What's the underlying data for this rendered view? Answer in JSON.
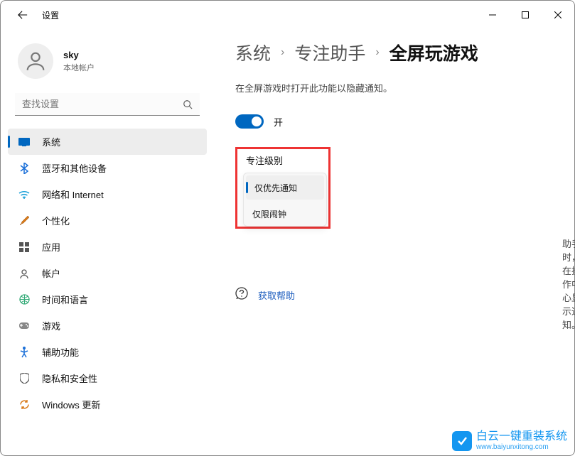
{
  "titlebar": {
    "title": "设置"
  },
  "user": {
    "name": "sky",
    "type": "本地帐户"
  },
  "search": {
    "placeholder": "查找设置"
  },
  "nav": [
    {
      "id": "system",
      "label": "系统",
      "active": true
    },
    {
      "id": "bluetooth",
      "label": "蓝牙和其他设备"
    },
    {
      "id": "network",
      "label": "网络和 Internet"
    },
    {
      "id": "personalization",
      "label": "个性化"
    },
    {
      "id": "apps",
      "label": "应用"
    },
    {
      "id": "accounts",
      "label": "帐户"
    },
    {
      "id": "time",
      "label": "时间和语言"
    },
    {
      "id": "gaming",
      "label": "游戏"
    },
    {
      "id": "accessibility",
      "label": "辅助功能"
    },
    {
      "id": "privacy",
      "label": "隐私和安全性"
    },
    {
      "id": "update",
      "label": "Windows 更新"
    }
  ],
  "breadcrumb": {
    "items": [
      "系统",
      "专注助手",
      "全屏玩游戏"
    ]
  },
  "main": {
    "description": "在全屏游戏时打开此功能以隐藏通知。",
    "toggle": {
      "state": "on",
      "label": "开"
    },
    "focus_level_label": "专注级别",
    "options": [
      {
        "label": "仅优先通知",
        "selected": true
      },
      {
        "label": "仅限闹钟",
        "selected": false
      }
    ],
    "partial_behind": "助手时，在操作中心显示通知。",
    "help_link": "获取帮助"
  },
  "watermark": {
    "brand": "白云一键重装系统",
    "url": "www.baiyunxitong.com"
  }
}
